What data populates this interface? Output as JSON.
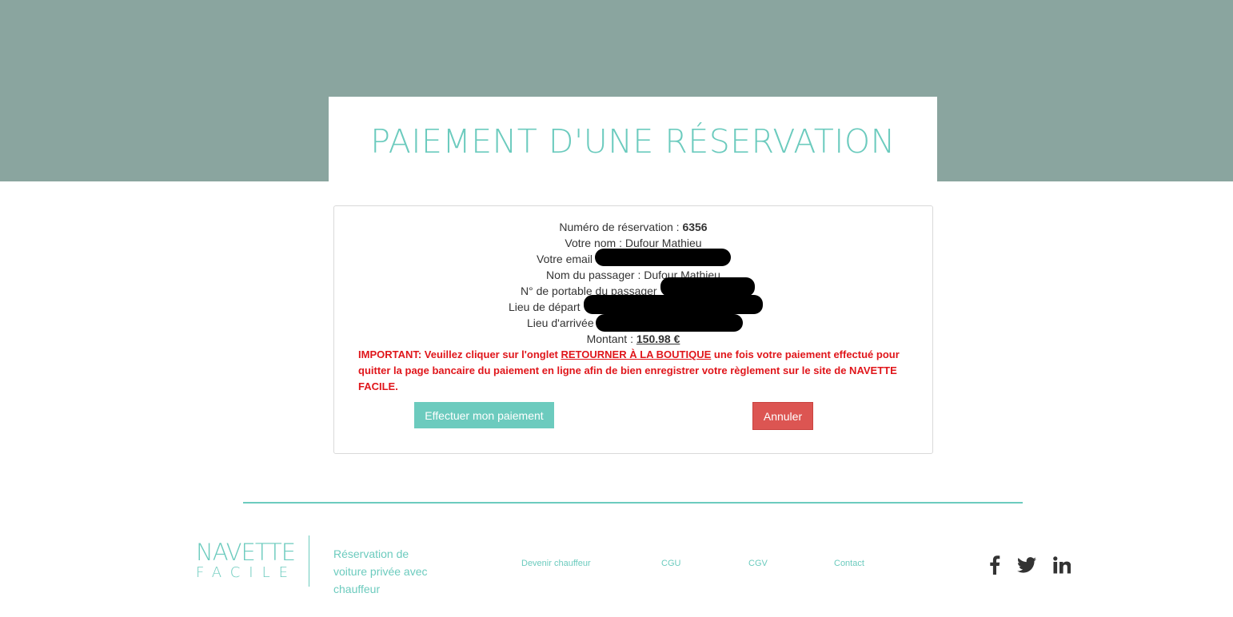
{
  "header": {
    "title": "PAIEMENT D'UNE RÉSERVATION"
  },
  "reservation": {
    "number_label": "Numéro de réservation : ",
    "number_value": "6356",
    "name_label": "Votre nom : Dufour Mathieu",
    "email_label": "Votre email",
    "passenger_name_label": "Nom du passager : Dufour Mathieu",
    "passenger_phone_label": "N° de portable du passager",
    "departure_label": "Lieu de départ",
    "arrival_label": "Lieu d'arrivée",
    "amount_label": "Montant : ",
    "amount_value": "150.98 €"
  },
  "notice": {
    "prefix": "IMPORTANT: Veuillez cliquer sur l'onglet ",
    "link": "RETOURNER À LA BOUTIQUE",
    "suffix": " une fois votre paiement effectué pour quitter la page bancaire du paiement en ligne afin de bien enregistrer votre règlement sur le site de NAVETTE FACILE."
  },
  "actions": {
    "pay_label": "Effectuer mon paiement",
    "cancel_label": "Annuler"
  },
  "footer": {
    "logo_top": "NAVETTE",
    "logo_bottom": "FACILE",
    "tagline": "Réservation de voiture privée avec chauffeur",
    "links": [
      "Devenir chauffeur",
      "CGU",
      "CGV",
      "Contact"
    ],
    "social": [
      "facebook-icon",
      "twitter-icon",
      "linkedin-icon"
    ]
  },
  "colors": {
    "hero_bg": "#8aa59f",
    "accent": "#6ccbbe",
    "danger": "#dc5552",
    "notice_red": "#e0161b",
    "redaction": "#000000"
  }
}
